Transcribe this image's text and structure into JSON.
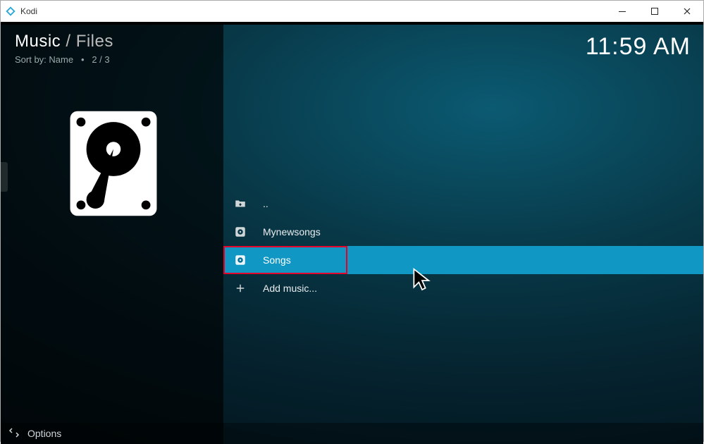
{
  "window": {
    "title": "Kodi"
  },
  "header": {
    "breadcrumb_main": "Music",
    "breadcrumb_sep": " / ",
    "breadcrumb_sub": "Files",
    "sort_label": "Sort by: Name",
    "count": "2 / 3"
  },
  "clock": "11:59 AM",
  "list": {
    "parent": {
      "label": ".."
    },
    "items": [
      {
        "label": "Mynewsongs"
      },
      {
        "label": "Songs"
      }
    ],
    "add_label": "Add music..."
  },
  "bottom": {
    "options_label": "Options"
  },
  "icons": {
    "folder_up": "folder-up-icon",
    "music_source": "music-source-icon",
    "add": "add-icon",
    "hdd": "hdd-icon",
    "options": "options-icon",
    "app_logo": "kodi-logo-icon"
  }
}
